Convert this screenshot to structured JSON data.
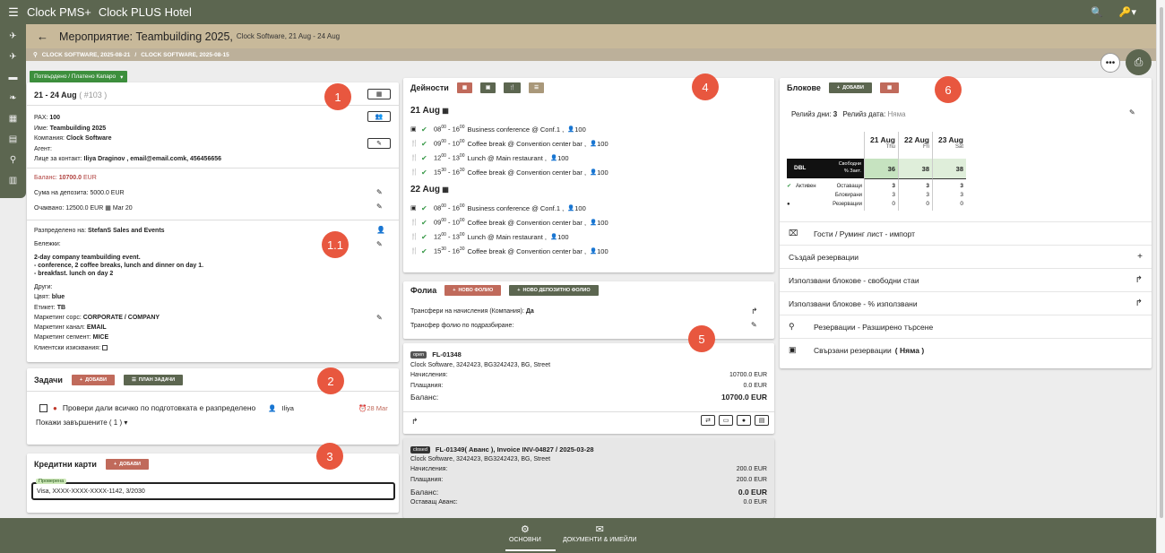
{
  "app": {
    "title": "Clock PMS+",
    "hotel": "Clock PLUS Hotel"
  },
  "header": {
    "title": "Мероприятие: Teambuilding 2025,",
    "subtitle": "Clock Software, 21 Aug - 24 Aug"
  },
  "breadcrumb": {
    "item1": "CLOCK SOFTWARE, 2025-08-21",
    "item2": "CLOCK SOFTWARE, 2025-08-15"
  },
  "status": {
    "label": "Потвърдено / Платено Капаро"
  },
  "event": {
    "dates": "21 - 24 Aug",
    "id": "( #103 )",
    "pax_label": "PAX:",
    "pax_value": "100",
    "name_label": "Име:",
    "name_value": "Teambuilding 2025",
    "company_label": "Компания:",
    "company_value": "Clock Software",
    "agent_label": "Агент:",
    "contact_label": "Лице за контакт:",
    "contact_value": "Iliya Draginov , email@email.comk, 456456656",
    "balance_label": "Баланс:",
    "balance_value": "10700.0",
    "balance_currency": "EUR",
    "deposit_label": "Сума на депозита:",
    "deposit_value": "5000.0 EUR",
    "expected_label": "Очаквано:",
    "expected_value": "12500.0 EUR",
    "expected_date": "Mar 20",
    "assigned_label": "Разпределено на:",
    "assigned_value": "StefanS  Sales and Events",
    "notes_label": "Бележки:",
    "notes_line1": "2-day company teambuilding event.",
    "notes_line2": "- conference, 2 coffee breaks, lunch and dinner on day 1.",
    "notes_line3": "- breakfast. lunch on day 2",
    "others_label": "Други:",
    "color_label": "Цвят:",
    "color_value": "blue",
    "tag_label": "Етикет:",
    "tag_value": "TB",
    "msource_label": "Маркетинг сорс:",
    "msource_value": "CORPORATE / COMPANY",
    "mchannel_label": "Маркетинг канал:",
    "mchannel_value": "EMAIL",
    "msegment_label": "Маркетинг сегмент:",
    "msegment_value": "MICE",
    "client_req_label": "Клиентски изисквания:"
  },
  "tasks": {
    "title": "Задачи",
    "add": "ДОБАВИ",
    "plan": "ПЛАН ЗАДАЧИ",
    "item_text": "Провери дали всичко по подготовката е разпределено",
    "item_user": "Iliya",
    "item_date": "28 Mar",
    "show_done": "Покажи завършените ( 1 )"
  },
  "cards": {
    "title": "Кредитни карти",
    "add": "ДОБАВИ",
    "verified": "Проверена",
    "card_value": "Visa, XXXX-XXXX-XXXX-1142, 3/2030"
  },
  "activities": {
    "title": "Дейности",
    "days": [
      {
        "date": "21 Aug",
        "rows": [
          {
            "h1": "08",
            "m1": "00",
            "h2": "16",
            "m2": "00",
            "text": "Business conference @ Conf.1 ,",
            "pax": "100"
          },
          {
            "h1": "09",
            "m1": "00",
            "h2": "10",
            "m2": "00",
            "text": "Coffee break @ Convention center bar ,",
            "pax": "100"
          },
          {
            "h1": "12",
            "m1": "00",
            "h2": "13",
            "m2": "00",
            "text": "Lunch @ Main restaurant ,",
            "pax": "100"
          },
          {
            "h1": "15",
            "m1": "30",
            "h2": "16",
            "m2": "30",
            "text": "Coffee break @ Convention center bar ,",
            "pax": "100"
          }
        ]
      },
      {
        "date": "22 Aug",
        "rows": [
          {
            "h1": "08",
            "m1": "00",
            "h2": "16",
            "m2": "00",
            "text": "Business conference @ Conf.1 ,",
            "pax": "100"
          },
          {
            "h1": "09",
            "m1": "00",
            "h2": "10",
            "m2": "00",
            "text": "Coffee break @ Convention center bar ,",
            "pax": "100"
          },
          {
            "h1": "12",
            "m1": "00",
            "h2": "13",
            "m2": "00",
            "text": "Lunch @ Main restaurant ,",
            "pax": "100"
          },
          {
            "h1": "15",
            "m1": "30",
            "h2": "16",
            "m2": "30",
            "text": "Coffee break @ Convention center bar ,",
            "pax": "100"
          }
        ]
      }
    ]
  },
  "folios": {
    "title": "Фолиа",
    "new_folio": "НОВО ФОЛИО",
    "new_deposit_folio": "НОВО ДЕПОЗИТНО ФОЛИО",
    "transfer_label": "Трансфери на начисления",
    "transfer_paren": "(Компания):",
    "transfer_value": "Да",
    "default_label": "Трансфер фолио по подразбиране:",
    "folio1": {
      "status": "open",
      "number": "FL-01348",
      "address": "Clock Software, 3242423, BG3242423, BG, Street",
      "charges_label": "Начисления:",
      "charges_value": "10700.0 EUR",
      "payments_label": "Плащания:",
      "payments_value": "0.0 EUR",
      "balance_label": "Баланс:",
      "balance_value": "10700.0 EUR"
    },
    "folio2": {
      "status": "closed",
      "number": "FL-01349",
      "number_suffix": "( Аванс ), Invoice INV-04827 / 2025-03-28",
      "address": "Clock Software, 3242423, BG3242423, BG, Street",
      "charges_label": "Начисления:",
      "charges_value": "200.0 EUR",
      "payments_label": "Плащания:",
      "payments_value": "200.0 EUR",
      "balance_label": "Баланс:",
      "balance_value": "0.0 EUR",
      "remaining_label": "Оставащ Аванс:",
      "remaining_value": "0.0 EUR"
    }
  },
  "blocks": {
    "title": "Блокове",
    "add": "ДОБАВИ",
    "release_days_label": "Релийз дни:",
    "release_days_value": "3",
    "release_date_label": "Релийз дата:",
    "release_date_value": "Няма",
    "days": [
      {
        "date": "21 Aug",
        "dow": "Thu",
        "free": "36",
        "remaining": "3",
        "blocked": "3",
        "reserved": "0"
      },
      {
        "date": "22 Aug",
        "dow": "Fri",
        "free": "38",
        "remaining": "3",
        "blocked": "3",
        "reserved": "0"
      },
      {
        "date": "23 Aug",
        "dow": "Sat",
        "free": "38",
        "remaining": "3",
        "blocked": "3",
        "reserved": "0"
      }
    ],
    "room_type": "DBL",
    "free_label": "Свободни",
    "occ_label": "% Зает.",
    "active_label": "Активен",
    "remaining_label": "Оставащи",
    "blocked_label": "Блокирани",
    "reserved_label": "Резервации",
    "menu": [
      "Гости / Руминг лист - импорт",
      "Създай резервации",
      "Използвани блокове - свободни стаи",
      "Използвани блокове - % използвани",
      "Резервации - Разширено търсене",
      "Свързани резервации"
    ],
    "linked_suffix": "( Няма )"
  },
  "markers": [
    "1",
    "1.1",
    "2",
    "3",
    "4",
    "5",
    "6"
  ],
  "bottom": {
    "tab1": "ОСНОВНИ",
    "tab2": "ДОКУМЕНТИ & ИМЕЙЛИ"
  },
  "colors": {
    "primary": "#5c6650",
    "header": "#c8b99a",
    "accent_red": "#c06a5b",
    "balance": "#b0413e",
    "success": "#3d8f3d",
    "marker": "#e8573f"
  }
}
